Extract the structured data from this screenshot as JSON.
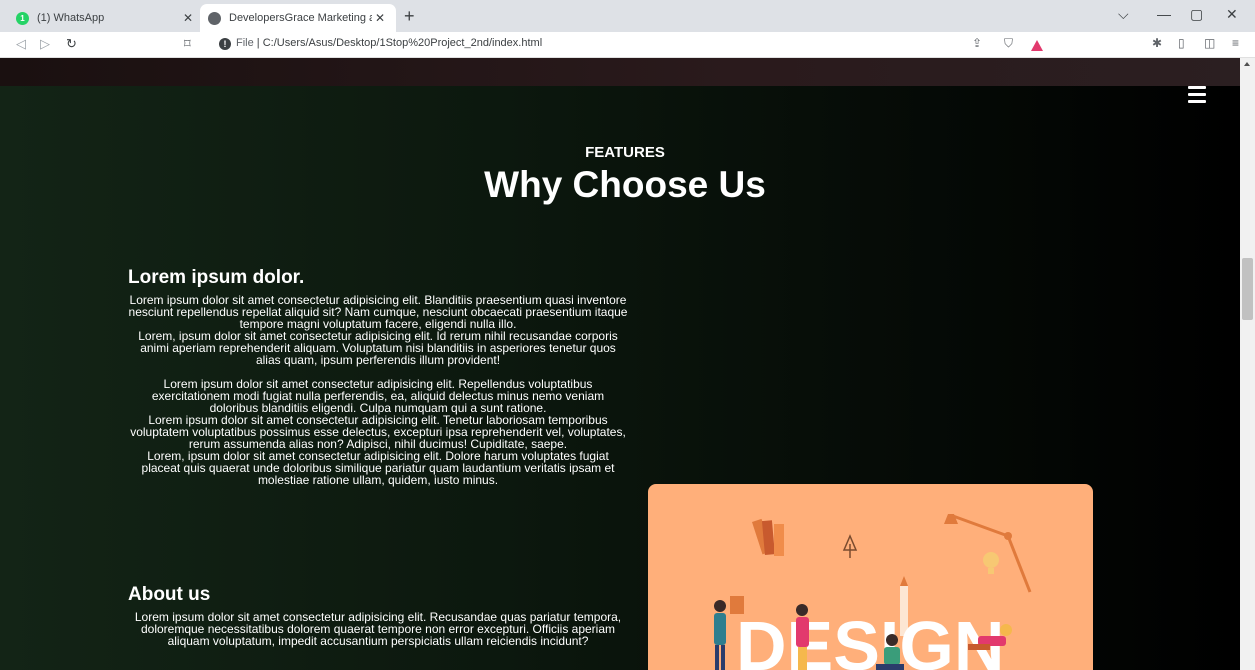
{
  "browser": {
    "tabs": [
      {
        "title": "(1) WhatsApp",
        "favicon": "whatsapp-icon",
        "badge": "1"
      },
      {
        "title": "DevelopersGrace Marketing and |",
        "favicon": "globe-icon"
      }
    ],
    "address": {
      "scheme": "File",
      "separator": "|",
      "path": "C:/Users/Asus/Desktop/1Stop%20Project_2nd/index.html"
    }
  },
  "page": {
    "eyebrow": "FEATURES",
    "heading": "Why Choose Us",
    "sections": [
      {
        "title": "Lorem ipsum dolor.",
        "paragraphs": [
          "Lorem ipsum dolor sit amet consectetur adipisicing elit. Blanditiis praesentium quasi inventore nesciunt repellendus repellat aliquid sit? Nam cumque, nesciunt obcaecati praesentium itaque tempore magni voluptatum facere, eligendi nulla illo.\nLorem, ipsum dolor sit amet consectetur adipisicing elit. Id rerum nihil recusandae corporis animi aperiam reprehenderit aliquam. Voluptatum nisi blanditiis in asperiores tenetur quos alias quam, ipsum perferendis illum provident!",
          "Lorem ipsum dolor sit amet consectetur adipisicing elit. Repellendus voluptatibus exercitationem modi fugiat nulla perferendis, ea, aliquid delectus minus nemo veniam doloribus blanditiis eligendi. Culpa numquam qui a sunt ratione.\nLorem ipsum dolor sit amet consectetur adipisicing elit. Tenetur laboriosam temporibus voluptatem voluptatibus possimus esse delectus, excepturi ipsa reprehenderit vel, voluptates, rerum assumenda alias non? Adipisci, nihil ducimus! Cupiditate, saepe.\nLorem, ipsum dolor sit amet consectetur adipisicing elit. Dolore harum voluptates fugiat placeat quis quaerat unde doloribus similique pariatur quam laudantium veritatis ipsam et molestiae ratione ullam, quidem, iusto minus."
        ]
      },
      {
        "title": "About us",
        "paragraphs": [
          "Lorem ipsum dolor sit amet consectetur adipisicing elit. Recusandae quas pariatur tempora, doloremque necessitatibus dolorem quaerat tempore non error excepturi. Officiis aperiam aliquam voluptatum, impedit accusantium perspiciatis ullam reiciendis incidunt?"
        ]
      }
    ],
    "illustration": {
      "word": "DESIGN",
      "icon": "design-team-illustration"
    }
  },
  "colors": {
    "page_bg_left": "#132416",
    "page_bg_right": "#000000",
    "illustration_bg": "#ffaf7a",
    "brave_accent": "#e2396d"
  }
}
